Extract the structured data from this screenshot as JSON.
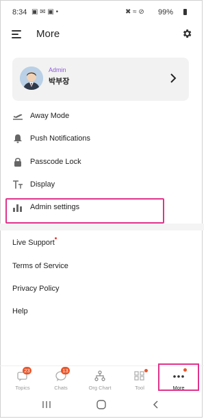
{
  "status_bar": {
    "time": "8:34",
    "battery": "99%"
  },
  "header": {
    "title": "More"
  },
  "profile": {
    "role": "Admin",
    "name": "박부장"
  },
  "menu": [
    {
      "label": "Away Mode",
      "icon": "airplane-icon"
    },
    {
      "label": "Push Notifications",
      "icon": "bell-icon"
    },
    {
      "label": "Passcode Lock",
      "icon": "lock-icon"
    },
    {
      "label": "Display",
      "icon": "text-size-icon"
    },
    {
      "label": "Admin settings",
      "icon": "bar-chart-icon"
    }
  ],
  "links": [
    {
      "label": "Live Support",
      "has_dot": true
    },
    {
      "label": "Terms of Service"
    },
    {
      "label": "Privacy Policy"
    },
    {
      "label": "Help"
    }
  ],
  "bottom_nav": [
    {
      "label": "Topics",
      "icon": "topics-icon",
      "badge": "23"
    },
    {
      "label": "Chats",
      "icon": "chats-icon",
      "badge": "13"
    },
    {
      "label": "Org Chart",
      "icon": "org-chart-icon"
    },
    {
      "label": "Tool",
      "icon": "tool-icon",
      "dot": true
    },
    {
      "label": "More",
      "icon": "more-icon",
      "dot": true,
      "active": true
    }
  ],
  "colors": {
    "accent_highlight": "#e0338b",
    "badge": "#e8562b",
    "role_text": "#8e5bd8"
  }
}
